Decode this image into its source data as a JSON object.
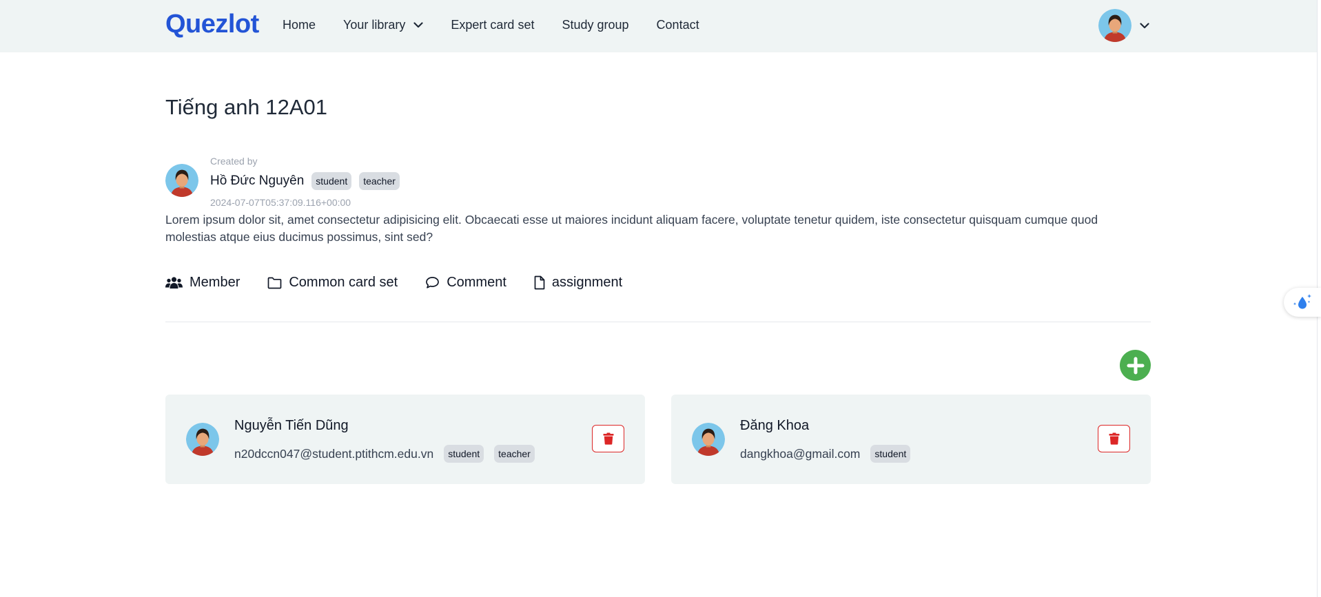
{
  "header": {
    "brand": "Quezlot",
    "nav": [
      {
        "label": "Home"
      },
      {
        "label": "Your library"
      },
      {
        "label": "Expert card set"
      },
      {
        "label": "Study group"
      },
      {
        "label": "Contact"
      }
    ],
    "user_menu_icon": "avatar",
    "user_menu_chevron": "chevron-down-icon"
  },
  "group": {
    "title": "Tiếng anh 12A01",
    "created_by_label": "Created by",
    "creator_name": "Hồ Đức Nguyên",
    "creator_roles": [
      "student",
      "teacher"
    ],
    "created_at": "2024-07-07T05:37:09.116+00:00",
    "description": "Lorem ipsum dolor sit, amet consectetur adipisicing elit. Obcaecati esse ut maiores incidunt aliquam facere, voluptate tenetur quidem, iste consectetur quisquam cumque quod molestias atque eius ducimus possimus, sint sed?"
  },
  "tabs": [
    {
      "label": "Member",
      "icon": "users-icon"
    },
    {
      "label": "Common card set",
      "icon": "folder-icon"
    },
    {
      "label": "Comment",
      "icon": "comment-icon"
    },
    {
      "label": "assignment",
      "icon": "file-icon"
    }
  ],
  "members": [
    {
      "name": "Nguyễn Tiến Dũng",
      "email": "n20dccn047@student.ptithcm.edu.vn",
      "roles": [
        "student",
        "teacher"
      ]
    },
    {
      "name": "Đăng Khoa",
      "email": "dangkhoa@gmail.com",
      "roles": [
        "student"
      ]
    }
  ],
  "colors": {
    "brand": "#2354d6",
    "header_bg": "#eff4f4",
    "card_bg": "#eff4f4",
    "add_button": "#4caf50",
    "delete_accent": "#dc2626"
  }
}
